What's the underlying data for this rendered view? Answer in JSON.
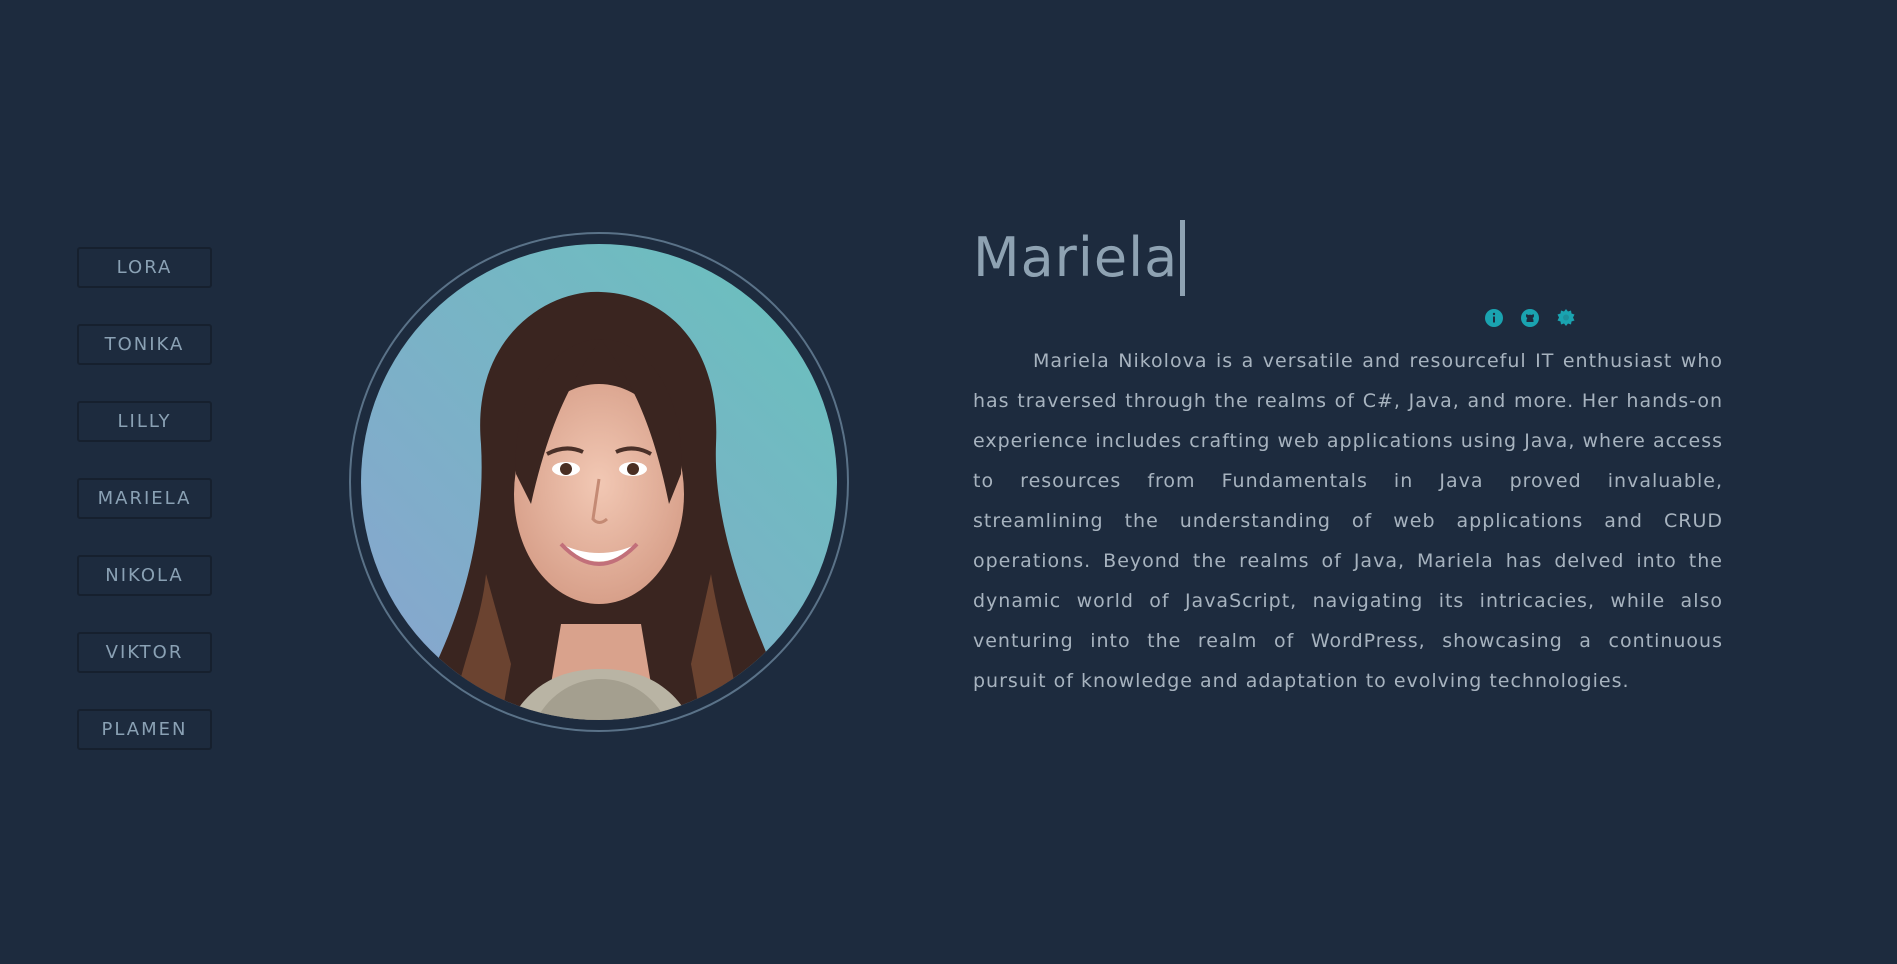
{
  "nav": {
    "items": [
      {
        "label": "LORA"
      },
      {
        "label": "TONIKA"
      },
      {
        "label": "LILLY"
      },
      {
        "label": "MARIELA"
      },
      {
        "label": "NIKOLA"
      },
      {
        "label": "VIKTOR"
      },
      {
        "label": "PLAMEN"
      }
    ]
  },
  "profile": {
    "name": "Mariela",
    "bio": "Mariela Nikolova is a versatile and resourceful IT enthusiast who has traversed through the realms of C#, Java, and more. Her hands-on experience includes crafting web applications using Java, where access to resources from Fundamentals in Java proved invaluable, streamlining the understanding of web applications and CRUD operations. Beyond the realms of Java, Mariela has delved into the dynamic world of JavaScript, navigating its intricacies, while also venturing into the realm of WordPress, showcasing a continuous pursuit of knowledge and adaptation to evolving technologies.",
    "photo_description_icon": "portrait-photo"
  },
  "icons": [
    "info-icon",
    "github-icon",
    "badge-icon"
  ],
  "colors": {
    "background": "#1d2b3e",
    "accent": "#1aa3b0",
    "text": "#a7b3bf",
    "button_text": "#8aa1b4"
  }
}
